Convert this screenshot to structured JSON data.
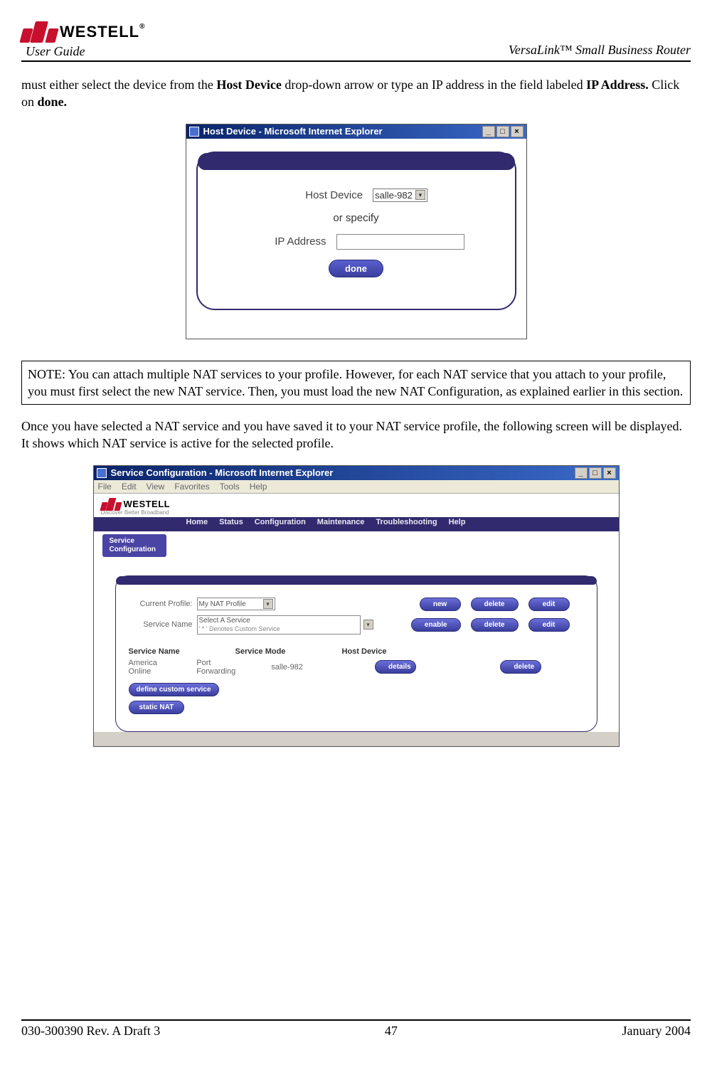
{
  "header": {
    "brand": "WESTELL",
    "user_guide": "User Guide",
    "product": "VersaLink™  Small Business Router"
  },
  "para1": {
    "pre": "must either select the device from the ",
    "b1": "Host Device",
    "mid1": " drop-down arrow or type an IP address in the field labeled ",
    "b2": "IP Address.",
    "mid2": " Click on ",
    "b3": "done."
  },
  "fig1": {
    "title": "Host Device - Microsoft Internet Explorer",
    "host_device_label": "Host Device",
    "host_device_value": "salle-982",
    "or_specify": "or specify",
    "ip_address_label": "IP Address",
    "ip_address_value": "",
    "done_btn": "done"
  },
  "note": "NOTE: You can attach multiple NAT services to your profile. However, for each NAT service that you attach to your profile, you must first select the new NAT service. Then, you must load the new NAT Configuration, as explained earlier in this section.",
  "para2": "Once you have selected a NAT service and you have saved it to your NAT service profile, the following screen will be displayed. It shows which NAT service is active for the selected profile.",
  "fig2": {
    "title": "Service Configuration - Microsoft Internet Explorer",
    "menu_items": [
      "File",
      "Edit",
      "View",
      "Favorites",
      "Tools",
      "Help"
    ],
    "brand": "WESTELL",
    "tagline": "Discover Better Broadband",
    "nav_items": [
      "Home",
      "Status",
      "Configuration",
      "Maintenance",
      "Troubleshooting",
      "Help"
    ],
    "subnav": "Service Configuration",
    "current_profile_label": "Current Profile:",
    "current_profile_value": "My NAT Profile",
    "service_name_label": "Service Name",
    "service_name_value": "Select A Service",
    "service_name_hint": "' * ' Denotes Custom Service",
    "btn_new": "new",
    "btn_delete": "delete",
    "btn_edit": "edit",
    "btn_enable": "enable",
    "headers": {
      "c1": "Service Name",
      "c2": "Service Mode",
      "c3": "Host Device"
    },
    "row": {
      "c1": "America Online",
      "c2": "Port Forwarding",
      "c3": "salle-982"
    },
    "btn_details": "details",
    "btn_define": "define custom service",
    "btn_static": "static NAT"
  },
  "footer": {
    "left": "030-300390 Rev. A Draft 3",
    "center": "47",
    "right": "January 2004"
  }
}
